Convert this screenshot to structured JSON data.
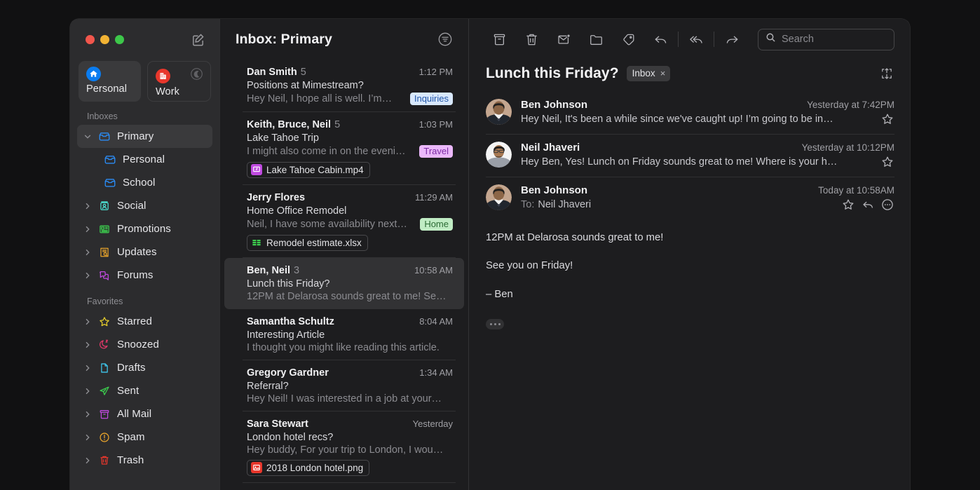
{
  "window": {
    "traffic_lights": [
      "close",
      "minimize",
      "zoom"
    ],
    "compose_icon": "compose-icon"
  },
  "sidebar": {
    "accounts": [
      {
        "label": "Personal",
        "icon": "home-icon",
        "color": "#0a7cf0",
        "active": true,
        "dnd": false
      },
      {
        "label": "Work",
        "icon": "building-icon",
        "color": "#e8372c",
        "active": false,
        "dnd": true
      }
    ],
    "sections": [
      {
        "title": "Inboxes",
        "items": [
          {
            "label": "Primary",
            "icon": "inbox-icon",
            "color": "#2b8cf5",
            "chevron": "down",
            "selected": true,
            "child": false
          },
          {
            "label": "Personal",
            "icon": "inbox-icon",
            "color": "#2b8cf5",
            "chevron": "none",
            "selected": false,
            "child": true
          },
          {
            "label": "School",
            "icon": "inbox-icon",
            "color": "#2b8cf5",
            "chevron": "none",
            "selected": false,
            "child": true
          },
          {
            "label": "Social",
            "icon": "social-icon",
            "color": "#4ad6c8",
            "chevron": "right",
            "selected": false,
            "child": false
          },
          {
            "label": "Promotions",
            "icon": "promotions-icon",
            "color": "#3dd14f",
            "chevron": "right",
            "selected": false,
            "child": false
          },
          {
            "label": "Updates",
            "icon": "updates-icon",
            "color": "#e9a42b",
            "chevron": "right",
            "selected": false,
            "child": false
          },
          {
            "label": "Forums",
            "icon": "forums-icon",
            "color": "#c04ae0",
            "chevron": "right",
            "selected": false,
            "child": false
          }
        ]
      },
      {
        "title": "Favorites",
        "items": [
          {
            "label": "Starred",
            "icon": "star-icon",
            "color": "#e9d02b",
            "chevron": "right",
            "selected": false,
            "child": false
          },
          {
            "label": "Snoozed",
            "icon": "snooze-moon-icon",
            "color": "#e8396b",
            "chevron": "right",
            "selected": false,
            "child": false
          },
          {
            "label": "Drafts",
            "icon": "document-icon",
            "color": "#3ec8ee",
            "chevron": "right",
            "selected": false,
            "child": false
          },
          {
            "label": "Sent",
            "icon": "paper-plane-icon",
            "color": "#3dd14f",
            "chevron": "right",
            "selected": false,
            "child": false
          },
          {
            "label": "All Mail",
            "icon": "archive-box-icon",
            "color": "#c04ae0",
            "chevron": "right",
            "selected": false,
            "child": false
          },
          {
            "label": "Spam",
            "icon": "exclamation-circle-icon",
            "color": "#e9a42b",
            "chevron": "right",
            "selected": false,
            "child": false
          },
          {
            "label": "Trash",
            "icon": "trash-icon",
            "color": "#e8372c",
            "chevron": "right",
            "selected": false,
            "child": false
          }
        ]
      }
    ]
  },
  "list": {
    "title": "Inbox: Primary",
    "filter_icon": "filter-icon",
    "messages": [
      {
        "from": "Dan Smith",
        "count": "5",
        "time": "1:12 PM",
        "subject": "Positions at Mimestream?",
        "preview": "Hey Neil, I hope all is well. I’m…",
        "tag": {
          "label": "Inquiries",
          "style": "blue"
        },
        "attachment": null,
        "selected": false
      },
      {
        "from": "Keith, Bruce, Neil",
        "count": "5",
        "time": "1:03 PM",
        "subject": "Lake Tahoe Trip",
        "preview": "I might also come in on the eveni…",
        "tag": {
          "label": "Travel",
          "style": "purple"
        },
        "attachment": {
          "name": "Lake Tahoe Cabin.mp4",
          "kind": "mp4"
        },
        "selected": false
      },
      {
        "from": "Jerry Flores",
        "count": "",
        "time": "11:29 AM",
        "subject": "Home Office Remodel",
        "preview": "Neil, I have some availability next…",
        "tag": {
          "label": "Home",
          "style": "green"
        },
        "attachment": {
          "name": "Remodel estimate.xlsx",
          "kind": "xlsx"
        },
        "selected": false
      },
      {
        "from": "Ben, Neil",
        "count": "3",
        "time": "10:58 AM",
        "subject": "Lunch this Friday?",
        "preview": "12PM at Delarosa sounds great to me! Se…",
        "tag": null,
        "attachment": null,
        "selected": true
      },
      {
        "from": "Samantha Schultz",
        "count": "",
        "time": "8:04 AM",
        "subject": "Interesting Article",
        "preview": "I thought you might like reading this article.",
        "tag": null,
        "attachment": null,
        "selected": false
      },
      {
        "from": "Gregory Gardner",
        "count": "",
        "time": "1:34 AM",
        "subject": "Referral?",
        "preview": "Hey Neil! I was interested in a job at your…",
        "tag": null,
        "attachment": null,
        "selected": false
      },
      {
        "from": "Sara Stewart",
        "count": "",
        "time": "Yesterday",
        "subject": "London hotel recs?",
        "preview": "Hey buddy, For your trip to London, I wou…",
        "tag": null,
        "attachment": {
          "name": "2018 London hotel.png",
          "kind": "png"
        },
        "selected": false
      }
    ]
  },
  "reader": {
    "toolbar": [
      {
        "name": "archive-icon",
        "label": "Archive"
      },
      {
        "name": "trash-icon",
        "label": "Delete"
      },
      {
        "name": "mark-unread-icon",
        "label": "Mark as Unread"
      },
      {
        "name": "move-folder-icon",
        "label": "Move"
      },
      {
        "name": "tag-icon",
        "label": "Label"
      },
      {
        "name": "reply-icon",
        "label": "Reply"
      },
      {
        "name": "reply-all-icon",
        "label": "Reply All"
      },
      {
        "name": "forward-icon",
        "label": "Forward"
      }
    ],
    "search": {
      "placeholder": "Search",
      "value": "",
      "icon": "search-icon"
    },
    "thread": {
      "title": "Lunch this Friday?",
      "chip_label": "Inbox",
      "chip_close": "×",
      "expand_icon": "expand-collapse-icon"
    },
    "messages": [
      {
        "name": "Ben Johnson",
        "date": "Yesterday at 7:42PM",
        "preview": "Hey Neil, It's been a while since we've caught up! I’m going to be in…",
        "to": null,
        "avatar": "ben-avatar",
        "actions": [
          "star-icon"
        ]
      },
      {
        "name": "Neil Jhaveri",
        "date": "Yesterday at 10:12PM",
        "preview": "Hey Ben, Yes! Lunch on Friday sounds great to me! Where is your h…",
        "to": null,
        "avatar": "neil-avatar",
        "actions": [
          "star-icon"
        ]
      },
      {
        "name": "Ben Johnson",
        "date": "Today at 10:58AM",
        "preview": null,
        "to": {
          "label": "To:",
          "value": "Neil Jhaveri"
        },
        "avatar": "ben-avatar",
        "actions": [
          "star-icon",
          "reply-icon",
          "more-icon"
        ]
      }
    ],
    "body": {
      "paragraphs": [
        "12PM at Delarosa sounds great to me!",
        "See you on Friday!",
        "– Ben"
      ],
      "more_button": "show-trimmed-content"
    }
  },
  "colors": {
    "accent_blue": "#0a7cf0",
    "window_bg": "#1d1d1f",
    "sidebar_bg": "#2c2c2e",
    "selection_bg": "#3a3a3c",
    "page_bg": "#111112"
  }
}
